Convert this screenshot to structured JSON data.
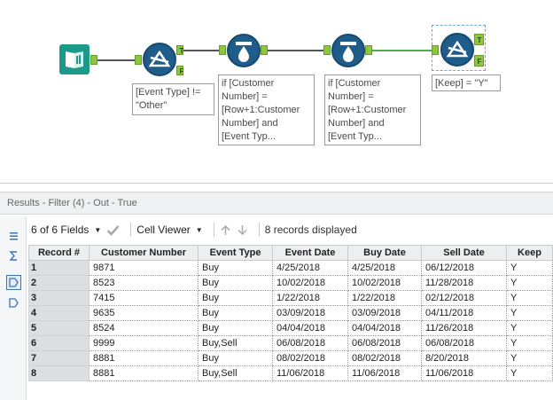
{
  "canvas": {
    "annotations": {
      "filter1": "[Event Type] !=\n\"Other\"",
      "formula1": "if [Customer\nNumber] =\n[Row+1:Customer\nNumber] and\n[Event Typ...",
      "formula2": "if [Customer\nNumber] =\n[Row+1:Customer\nNumber] and\n[Event Typ...",
      "filter2": "[Keep] = \"Y\""
    },
    "anchors": {
      "true": "T",
      "false": "F"
    }
  },
  "results": {
    "header": "Results - Filter (4) - Out - True",
    "toolbar": {
      "fields_label": "6 of 6 Fields",
      "viewer_label": "Cell Viewer",
      "records_displayed": "8 records displayed"
    },
    "columns": [
      "Record #",
      "Customer Number",
      "Event Type",
      "Event Date",
      "Buy Date",
      "Sell Date",
      "Keep"
    ],
    "rows": [
      [
        "1",
        "9871",
        "Buy",
        "4/25/2018",
        "4/25/2018",
        "06/12/2018",
        "Y"
      ],
      [
        "2",
        "8523",
        "Buy",
        "10/02/2018",
        "10/02/2018",
        "11/28/2018",
        "Y"
      ],
      [
        "3",
        "7415",
        "Buy",
        "1/22/2018",
        "1/22/2018",
        "02/12/2018",
        "Y"
      ],
      [
        "4",
        "9635",
        "Buy",
        "03/09/2018",
        "03/09/2018",
        "04/11/2018",
        "Y"
      ],
      [
        "5",
        "8524",
        "Buy",
        "04/04/2018",
        "04/04/2018",
        "11/26/2018",
        "Y"
      ],
      [
        "6",
        "9999",
        "Buy,Sell",
        "06/08/2018",
        "06/08/2018",
        "06/08/2018",
        "Y"
      ],
      [
        "7",
        "8881",
        "Buy",
        "08/02/2018",
        "08/02/2018",
        "8/20/2018",
        "Y"
      ],
      [
        "8",
        "8881",
        "Buy,Sell",
        "11/06/2018",
        "11/06/2018",
        "11/06/2018",
        "Y"
      ]
    ]
  },
  "icons": {
    "input": "input-data-icon",
    "filter": "filter-icon",
    "formula": "multi-row-formula-icon",
    "check": "apply-check-icon",
    "up": "arrow-up-icon",
    "down": "arrow-down-icon"
  },
  "colors": {
    "tool_blue": "#1f5c8a",
    "input_teal": "#1b9a8a",
    "anchor_green": "#8dc63f",
    "connector_green": "#4caf50"
  }
}
